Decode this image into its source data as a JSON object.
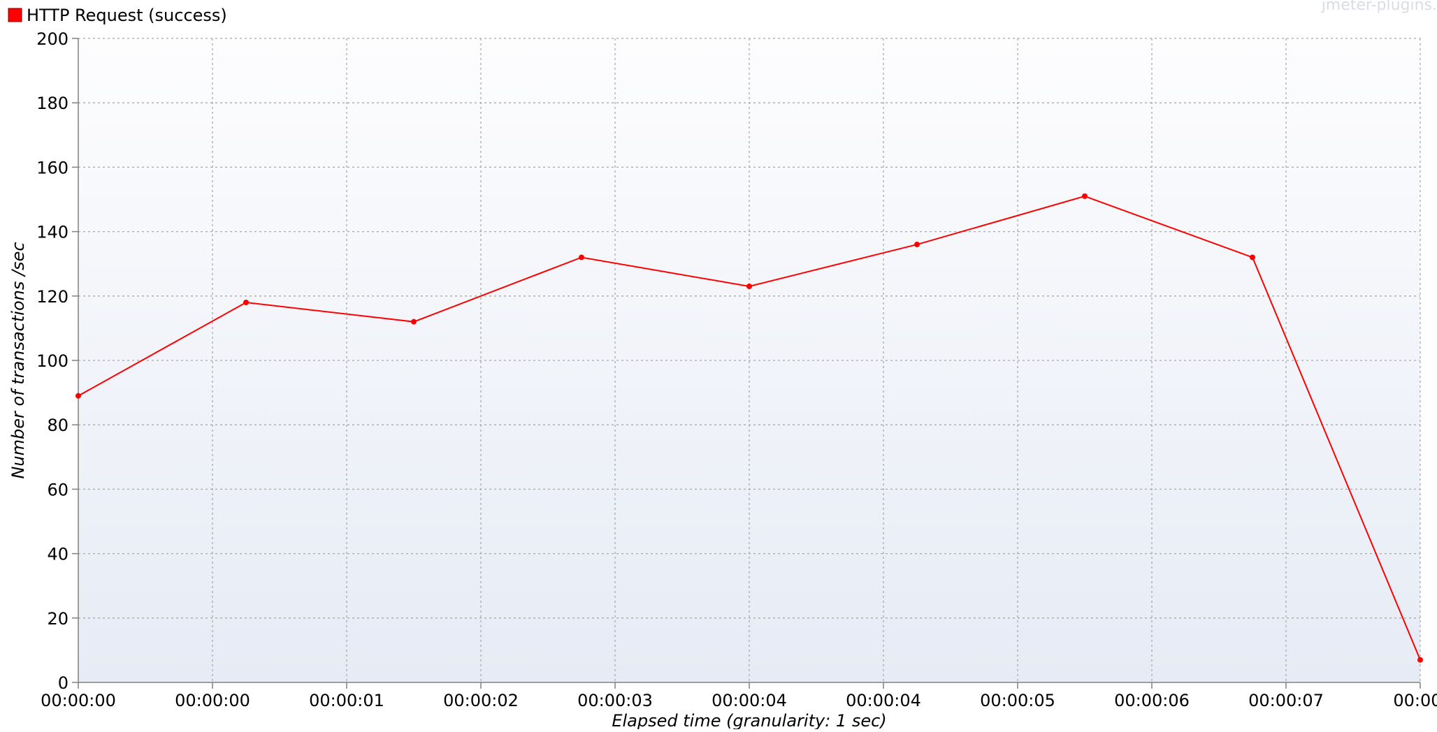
{
  "watermark": "jmeter-plugins.",
  "colors": {
    "series": "#ff0000",
    "grid": "#a8a8a8",
    "axis": "#808080",
    "plot_top": "#fdfdfe",
    "plot_bottom": "#e6ebf5",
    "text": "#000000",
    "watermark": "#d8dce4"
  },
  "chart_data": {
    "type": "line",
    "title": "",
    "xlabel": "Elapsed time (granularity: 1 sec)",
    "ylabel": "Number of transactions /sec",
    "ylim": [
      0,
      200
    ],
    "yticks": [
      0,
      20,
      40,
      60,
      80,
      100,
      120,
      140,
      160,
      180,
      200
    ],
    "xlim": [
      0,
      8
    ],
    "xticks": [
      0,
      0.8,
      1.6,
      2.4,
      3.2,
      4.0,
      4.8,
      5.6,
      6.4,
      7.2,
      8.0
    ],
    "xtick_labels": [
      "00:00:00",
      "00:00:00",
      "00:00:01",
      "00:00:02",
      "00:00:03",
      "00:00:04",
      "00:00:04",
      "00:00:05",
      "00:00:06",
      "00:00:07",
      "00:00:"
    ],
    "grid": true,
    "legend": "top-left",
    "series": [
      {
        "name": "HTTP Request (success)",
        "color": "#ff0000",
        "points": [
          {
            "x": 0.0,
            "y": 89
          },
          {
            "x": 1.0,
            "y": 118
          },
          {
            "x": 2.0,
            "y": 112
          },
          {
            "x": 3.0,
            "y": 132
          },
          {
            "x": 4.0,
            "y": 123
          },
          {
            "x": 5.0,
            "y": 136
          },
          {
            "x": 6.0,
            "y": 151
          },
          {
            "x": 7.0,
            "y": 132
          },
          {
            "x": 8.0,
            "y": 7
          }
        ]
      }
    ]
  }
}
